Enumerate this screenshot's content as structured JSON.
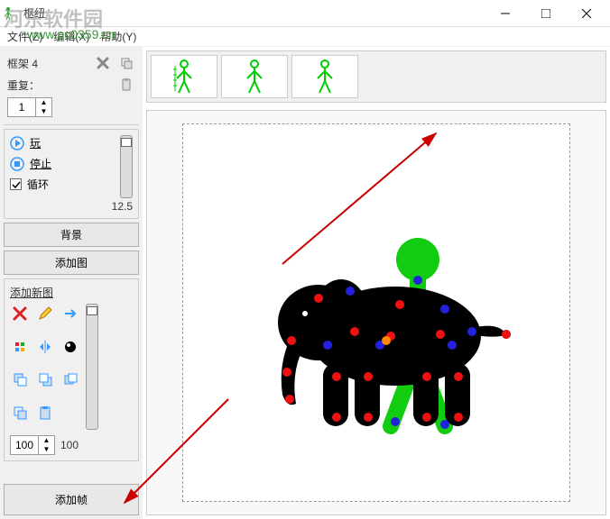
{
  "window": {
    "title": "枢纽"
  },
  "menu": {
    "file": "文件(Z)",
    "edit": "编辑(X)",
    "help": "帮助(Y)"
  },
  "frame_panel": {
    "frame_label": "框架 4",
    "repeat_label": "重复：",
    "repeat_value": "1"
  },
  "play_panel": {
    "play": "玩",
    "stop": "停止",
    "loop": "循环",
    "speed_value": "12.5"
  },
  "buttons": {
    "background": "背景",
    "add_figure": "添加图",
    "add_frame": "添加帧"
  },
  "tools": {
    "title": "添加新图",
    "scale_value": "100",
    "scale_display": "100"
  },
  "watermarks": {
    "main": "河东软件园",
    "url": "www.pc0359.cn"
  },
  "frames": [
    {
      "id": 1
    },
    {
      "id": 2
    },
    {
      "id": 3
    }
  ]
}
